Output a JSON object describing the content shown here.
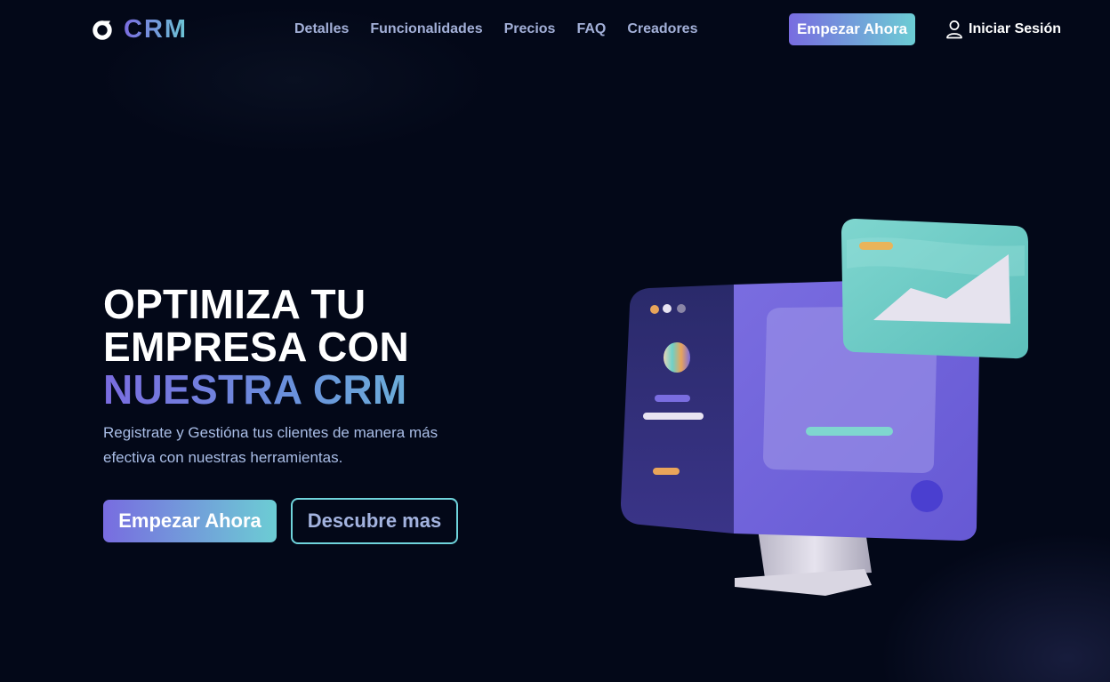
{
  "header": {
    "logo_text": "CRM",
    "nav": [
      "Detalles",
      "Funcionalidades",
      "Precios",
      "FAQ",
      "Creadores"
    ],
    "cta_label": "Empezar Ahora",
    "login_label": "Iniciar Sesión"
  },
  "hero": {
    "title_line1": "OPTIMIZA TU",
    "title_line2": "EMPRESA CON",
    "title_line3": "NUESTRA CRM",
    "subtitle": "Registrate y Gestióna tus clientes de manera más efectiva con nuestras herramientas.",
    "primary_button": "Empezar Ahora",
    "secondary_button": "Descubre mas"
  },
  "icons": {
    "logo": "crm-logo-icon",
    "login": "user-icon",
    "illustration": "computer-dashboard-illustration"
  },
  "colors": {
    "background": "#030818",
    "accent_start": "#786ce0",
    "accent_end": "#6ccdd4",
    "nav_text": "#a3b0d8",
    "subtitle_text": "#a9bde6",
    "outline_button_border": "#6fd4dc"
  }
}
